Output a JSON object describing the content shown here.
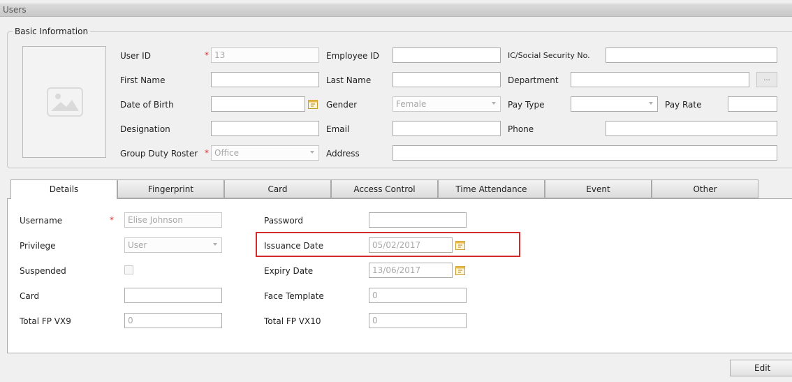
{
  "window": {
    "title": "Users"
  },
  "basic_info": {
    "legend": "Basic Information",
    "user_id": {
      "label": "User ID",
      "value": "13"
    },
    "employee_id": {
      "label": "Employee ID",
      "value": ""
    },
    "ic_no": {
      "label": "IC/Social Security No.",
      "value": ""
    },
    "first_name": {
      "label": "First Name",
      "value": ""
    },
    "last_name": {
      "label": "Last Name",
      "value": ""
    },
    "department": {
      "label": "Department",
      "value": "",
      "button": "..."
    },
    "dob": {
      "label": "Date of Birth",
      "value": ""
    },
    "gender": {
      "label": "Gender",
      "value": "Female"
    },
    "pay_type": {
      "label": "Pay Type",
      "value": ""
    },
    "pay_rate": {
      "label": "Pay Rate",
      "value": ""
    },
    "designation": {
      "label": "Designation",
      "value": ""
    },
    "email": {
      "label": "Email",
      "value": ""
    },
    "phone": {
      "label": "Phone",
      "value": ""
    },
    "group_duty_roster": {
      "label": "Group Duty Roster",
      "value": "Office"
    },
    "address": {
      "label": "Address",
      "value": ""
    },
    "required_mark": "*"
  },
  "tabs": [
    "Details",
    "Fingerprint",
    "Card",
    "Access Control",
    "Time Attendance",
    "Event",
    "Other"
  ],
  "details": {
    "username": {
      "label": "Username",
      "value": "Elise Johnson"
    },
    "privilege": {
      "label": "Privilege",
      "value": "User"
    },
    "suspended": {
      "label": "Suspended"
    },
    "card": {
      "label": "Card",
      "value": ""
    },
    "total_fp_vx9": {
      "label": "Total FP VX9",
      "value": "0"
    },
    "password": {
      "label": "Password",
      "value": ""
    },
    "issuance_date": {
      "label": "Issuance Date",
      "value": "05/02/2017"
    },
    "expiry_date": {
      "label": "Expiry Date",
      "value": "13/06/2017"
    },
    "face_template": {
      "label": "Face Template",
      "value": "0"
    },
    "total_fp_vx10": {
      "label": "Total FP VX10",
      "value": "0"
    }
  },
  "footer": {
    "edit_label": "Edit"
  },
  "colors": {
    "required": "#e03030",
    "highlight": "#d42a2a",
    "calendar": "#e8b84a"
  },
  "icons": {
    "photo": "image-placeholder-icon",
    "calendar": "calendar-icon"
  }
}
